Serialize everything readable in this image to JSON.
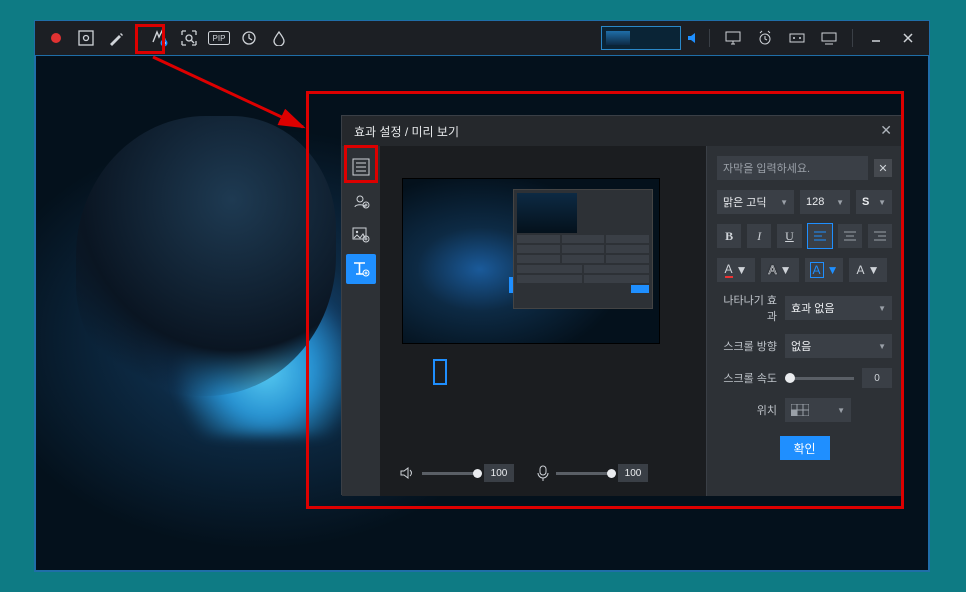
{
  "toolbar": {
    "record": "●",
    "pip_label": "PIP"
  },
  "dialog": {
    "title": "효과 설정 / 미리 보기",
    "caption_placeholder": "자막을 입력하세요.",
    "font_name": "맑은 고딕",
    "font_size": "128",
    "style_label": "S",
    "bold": "B",
    "italic": "I",
    "underline": "U",
    "color_label": "A",
    "appear_label": "나타나기 효과",
    "appear_value": "효과 없음",
    "scroll_dir_label": "스크롤 방향",
    "scroll_dir_value": "없음",
    "scroll_speed_label": "스크롤 속도",
    "scroll_speed_value": "0",
    "position_label": "위치",
    "ok": "확인",
    "vol1": "100",
    "vol2": "100"
  }
}
